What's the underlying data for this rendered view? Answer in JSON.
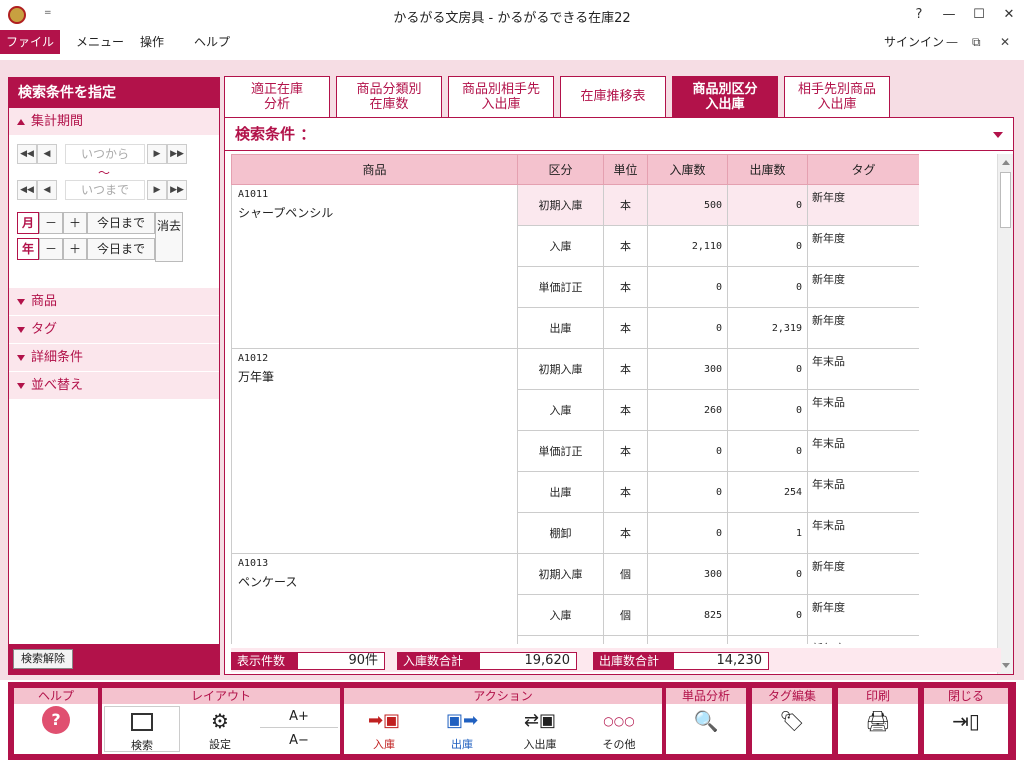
{
  "window": {
    "title": "かるがる文房具 - かるがるできる在庫22",
    "qa": "=",
    "controls": [
      "?",
      "—",
      "☐",
      "✕"
    ]
  },
  "menu": {
    "file": "ファイル",
    "items": [
      "メニュー",
      "操作",
      "ヘルプ"
    ],
    "signin": "サインイン",
    "mini": [
      "—",
      "⧉",
      "✕"
    ]
  },
  "sidebar": {
    "title": "検索条件を指定",
    "period_label": "集計期間",
    "from_placeholder": "いつから",
    "to_placeholder": "いつまで",
    "tilde": "～",
    "month": "月",
    "year": "年",
    "minus": "－",
    "plus": "＋",
    "today": "今日まで",
    "clear": "消去",
    "sections": [
      "商品",
      "タグ",
      "詳細条件",
      "並べ替え"
    ],
    "clear_search": "検索解除"
  },
  "tabs": [
    {
      "l1": "適正在庫",
      "l2": "分析"
    },
    {
      "l1": "商品分類別",
      "l2": "在庫数"
    },
    {
      "l1": "商品別相手先",
      "l2": "入出庫"
    },
    {
      "l1": "在庫推移表",
      "l2": ""
    },
    {
      "l1": "商品別区分",
      "l2": "入出庫"
    },
    {
      "l1": "相手先別商品",
      "l2": "入出庫"
    }
  ],
  "main": {
    "condition": "検索条件 ：",
    "headers": [
      "商品",
      "区分",
      "単位",
      "入庫数",
      "出庫数",
      "タグ"
    ],
    "rows": [
      {
        "code": "A1011",
        "name": "シャープペンシル",
        "lines": [
          {
            "kubun": "初期入庫",
            "unit": "本",
            "in": "500",
            "out": "0",
            "tag": "新年度"
          },
          {
            "kubun": "入庫",
            "unit": "本",
            "in": "2,110",
            "out": "0",
            "tag": "新年度"
          },
          {
            "kubun": "単価訂正",
            "unit": "本",
            "in": "0",
            "out": "0",
            "tag": "新年度"
          },
          {
            "kubun": "出庫",
            "unit": "本",
            "in": "0",
            "out": "2,319",
            "tag": "新年度"
          }
        ]
      },
      {
        "code": "A1012",
        "name": "万年筆",
        "lines": [
          {
            "kubun": "初期入庫",
            "unit": "本",
            "in": "300",
            "out": "0",
            "tag": "年末品"
          },
          {
            "kubun": "入庫",
            "unit": "本",
            "in": "260",
            "out": "0",
            "tag": "年末品"
          },
          {
            "kubun": "単価訂正",
            "unit": "本",
            "in": "0",
            "out": "0",
            "tag": "年末品"
          },
          {
            "kubun": "出庫",
            "unit": "本",
            "in": "0",
            "out": "254",
            "tag": "年末品"
          },
          {
            "kubun": "棚卸",
            "unit": "本",
            "in": "0",
            "out": "1",
            "tag": "年末品"
          }
        ]
      },
      {
        "code": "A1013",
        "name": "ペンケース",
        "lines": [
          {
            "kubun": "初期入庫",
            "unit": "個",
            "in": "300",
            "out": "0",
            "tag": "新年度"
          },
          {
            "kubun": "入庫",
            "unit": "個",
            "in": "825",
            "out": "0",
            "tag": "新年度"
          },
          {
            "kubun": "",
            "unit": "",
            "in": "",
            "out": "",
            "tag": "新年度"
          }
        ]
      }
    ],
    "summary": {
      "count_label": "表示件数",
      "count": "90件",
      "in_label": "入庫数合計",
      "in": "19,620",
      "out_label": "出庫数合計",
      "out": "14,230"
    }
  },
  "bottom": {
    "help": {
      "label": "ヘルプ"
    },
    "layout": {
      "label": "レイアウト",
      "search": "検索",
      "settings": "設定",
      "font_up": "A+",
      "font_down": "A−"
    },
    "action": {
      "label": "アクション",
      "in": "入庫",
      "out": "出庫",
      "inout": "入出庫",
      "other": "その他",
      "dots": "○○○"
    },
    "single": {
      "label": "単品分析"
    },
    "tag": {
      "label": "タグ編集"
    },
    "print": {
      "label": "印刷"
    },
    "close": {
      "label": "閉じる"
    }
  },
  "colors": {
    "accent": "#b2124a",
    "light": "#f6dde4",
    "header": "#f4c2ce"
  }
}
